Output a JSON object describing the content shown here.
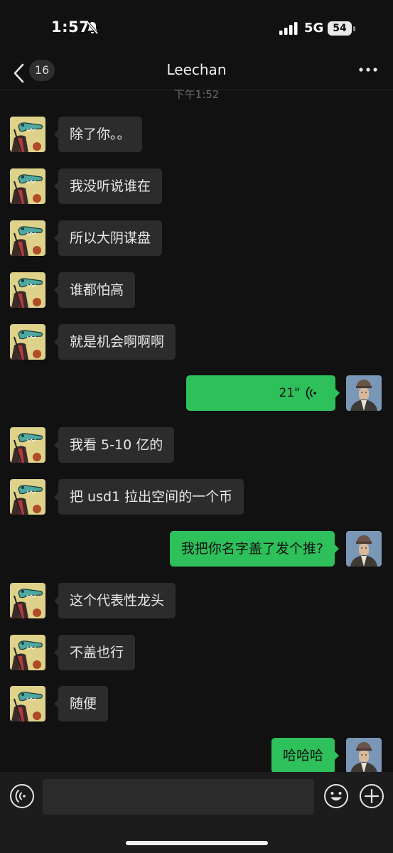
{
  "status_bar": {
    "time": "1:57",
    "network": "5G",
    "battery": "54"
  },
  "nav": {
    "unread_count": "16",
    "title": "Leechan"
  },
  "time_divider": "下午1:52",
  "messages": [
    {
      "side": "in",
      "type": "text",
      "text": "除了你。。"
    },
    {
      "side": "in",
      "type": "text",
      "text": "我没听说谁在"
    },
    {
      "side": "in",
      "type": "text",
      "text": "所以大阴谋盘"
    },
    {
      "side": "in",
      "type": "text",
      "text": "谁都怕高"
    },
    {
      "side": "in",
      "type": "text",
      "text": "就是机会啊啊啊"
    },
    {
      "side": "out",
      "type": "voice",
      "text": "21\""
    },
    {
      "side": "in",
      "type": "text",
      "text": "我看 5-10 亿的"
    },
    {
      "side": "in",
      "type": "text",
      "text": "把 usd1 拉出空间的一个币"
    },
    {
      "side": "out",
      "type": "text",
      "text": "我把你名字盖了发个推?"
    },
    {
      "side": "in",
      "type": "text",
      "text": "这个代表性龙头"
    },
    {
      "side": "in",
      "type": "text",
      "text": "不盖也行"
    },
    {
      "side": "in",
      "type": "text",
      "text": "随便"
    },
    {
      "side": "out",
      "type": "text",
      "text": "哈哈哈"
    }
  ],
  "input": {
    "value": "",
    "placeholder": ""
  },
  "colors": {
    "background": "#111111",
    "incoming_bubble": "#2c2c2c",
    "outgoing_bubble": "#2ec05a"
  },
  "icons": {
    "back": "chevron-left-icon",
    "more": "more-dots-icon",
    "voice_toggle": "voice-icon",
    "emoji": "emoji-icon",
    "plus": "plus-icon",
    "silent": "bell-slash-icon",
    "signal": "signal-icon"
  }
}
